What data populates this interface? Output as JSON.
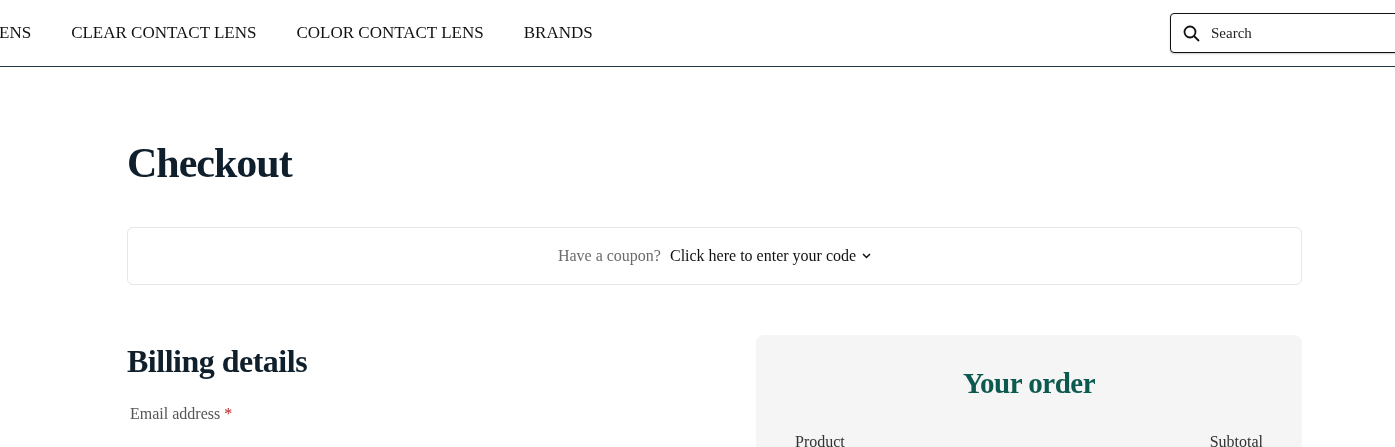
{
  "nav": {
    "items": [
      "ENS",
      "CLEAR CONTACT LENS",
      "COLOR CONTACT LENS",
      "BRANDS"
    ],
    "search": {
      "placeholder": "Search"
    }
  },
  "page_title": "Checkout",
  "coupon": {
    "prompt": "Have a coupon?",
    "link": "Click here to enter your code"
  },
  "billing": {
    "title": "Billing details",
    "fields": [
      {
        "label": "Email address",
        "required_mark": "*"
      }
    ]
  },
  "order": {
    "title": "Your order",
    "columns": [
      "Product",
      "Subtotal"
    ]
  }
}
